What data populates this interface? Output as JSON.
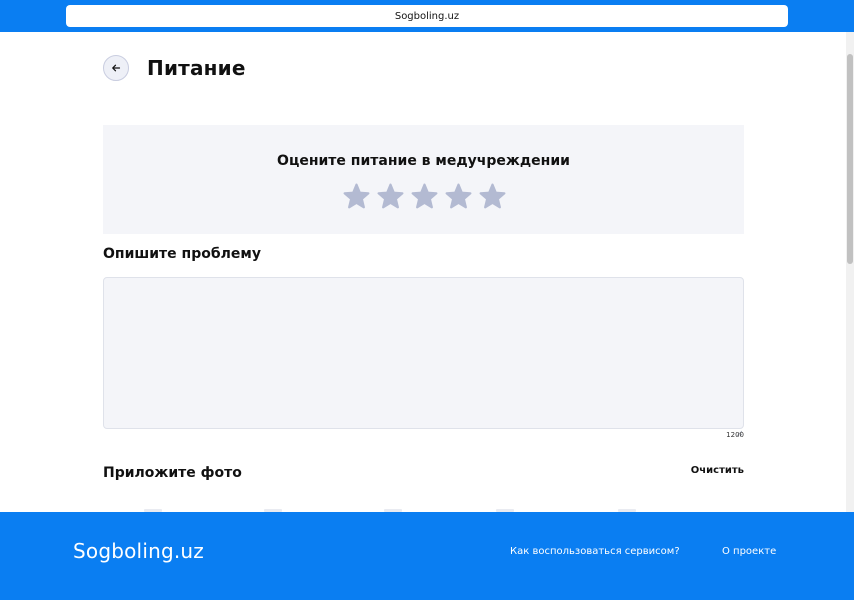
{
  "browser": {
    "url_text": "Sogboling.uz"
  },
  "header": {
    "title": "Питание",
    "back_icon": "arrow-left-icon"
  },
  "rating": {
    "title": "Оцените питание в медучреждении",
    "max_stars": 5,
    "selected": 0,
    "star_color": "#b3bad2",
    "star_icon": "star-icon"
  },
  "problem": {
    "label": "Опишите проблему",
    "value": "",
    "counter": "1200"
  },
  "photo": {
    "label": "Приложите фото",
    "clear_label": "Очистить"
  },
  "footer": {
    "logo": "Sogboling.uz",
    "link_how": "Как воспользоваться сервисом?",
    "link_about": "О проекте"
  },
  "colors": {
    "brand_blue": "#0a7ef2",
    "panel_bg": "#f4f5f9"
  }
}
